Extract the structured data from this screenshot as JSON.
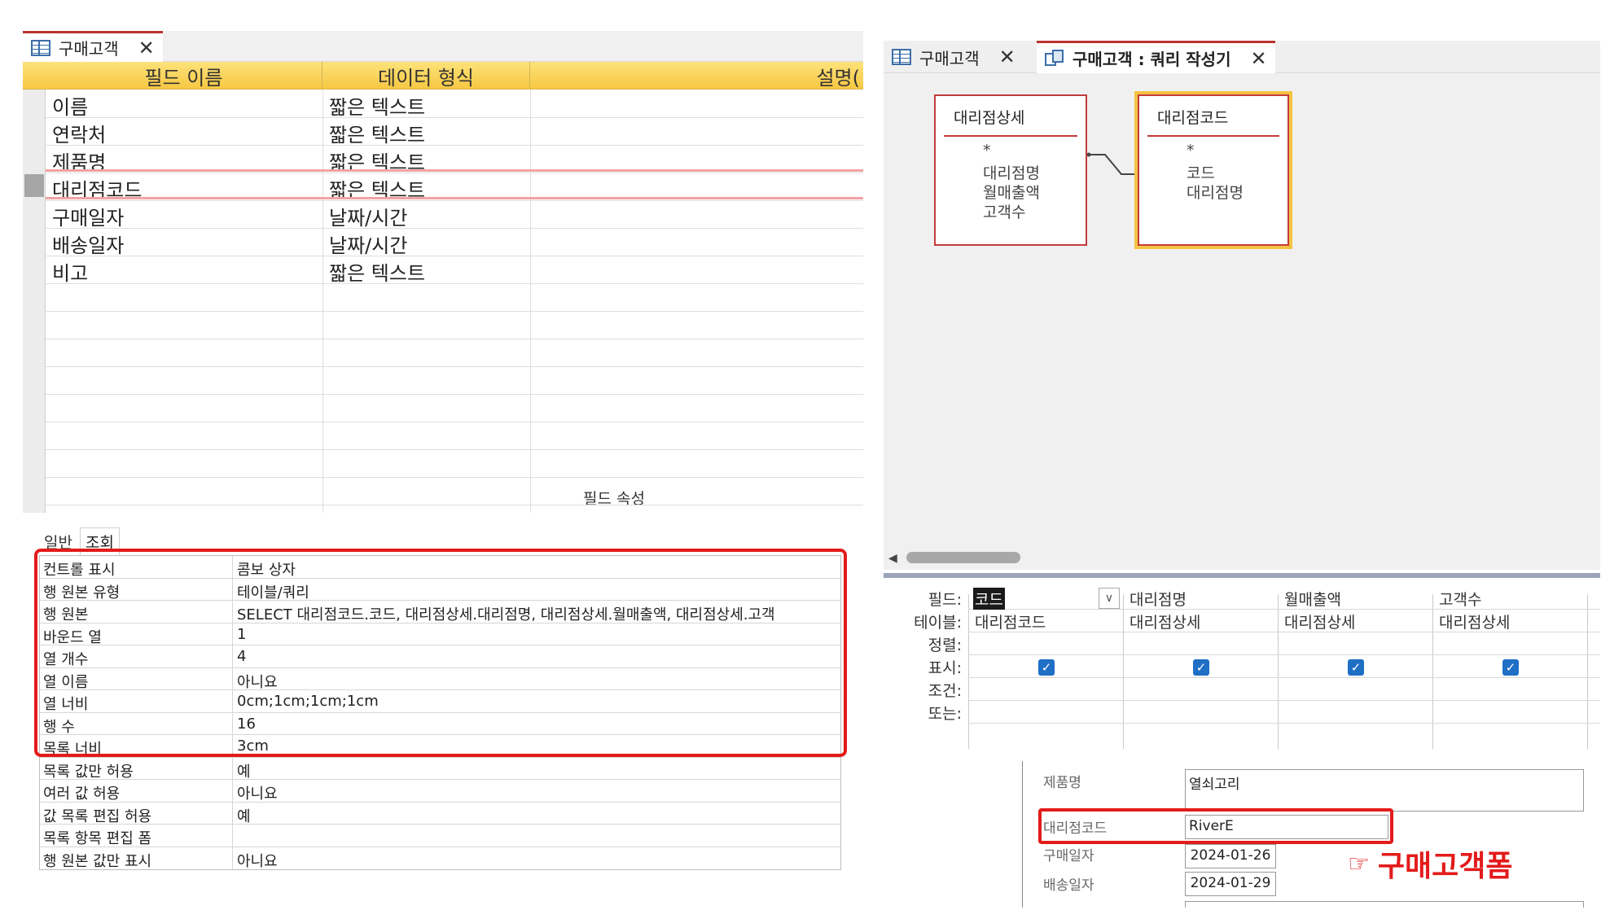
{
  "left_tab": {
    "title": "구매고객",
    "close": "✕"
  },
  "columns": {
    "field_name": "필드 이름",
    "data_type": "데이터 형식",
    "description": "설명("
  },
  "fields": [
    {
      "name": "이름",
      "type": "짧은 텍스트"
    },
    {
      "name": "연락처",
      "type": "짧은 텍스트"
    },
    {
      "name": "제품명",
      "type": "짧은 텍스트"
    },
    {
      "name": "대리점코드",
      "type": "짧은 텍스트"
    },
    {
      "name": "구매일자",
      "type": "날짜/시간"
    },
    {
      "name": "배송일자",
      "type": "날짜/시간"
    },
    {
      "name": "비고",
      "type": "짧은 텍스트"
    }
  ],
  "field_properties": {
    "title": "필드 속성",
    "tabs": {
      "general": "일반",
      "lookup": "조회"
    },
    "rows": [
      {
        "name": "컨트롤 표시",
        "value": "콤보 상자"
      },
      {
        "name": "행 원본 유형",
        "value": "테이블/쿼리"
      },
      {
        "name": "행 원본",
        "value": "SELECT 대리점코드.코드, 대리점상세.대리점명, 대리점상세.월매출액, 대리점상세.고객"
      },
      {
        "name": "바운드 열",
        "value": "1"
      },
      {
        "name": "열 개수",
        "value": "4"
      },
      {
        "name": "열 이름",
        "value": "아니요"
      },
      {
        "name": "열 너비",
        "value": "0cm;1cm;1cm;1cm"
      },
      {
        "name": "행 수",
        "value": "16"
      },
      {
        "name": "목록 너비",
        "value": "3cm"
      },
      {
        "name": "목록 값만 허용",
        "value": "예"
      },
      {
        "name": "여러 값 허용",
        "value": "아니요"
      },
      {
        "name": "값 목록 편집 허용",
        "value": "예"
      },
      {
        "name": "목록 항목 편집 폼",
        "value": ""
      },
      {
        "name": "행 원본 값만 표시",
        "value": "아니요"
      }
    ]
  },
  "right_tabs": [
    {
      "title": "구매고객",
      "close": "✕"
    },
    {
      "title": "구매고객 : 쿼리 작성기",
      "close": "✕"
    }
  ],
  "tables": [
    {
      "title": "대리점상세",
      "fields": [
        "*",
        "대리점명",
        "월매출액",
        "고객수"
      ]
    },
    {
      "title": "대리점코드",
      "fields": [
        "*",
        "코드",
        "대리점명"
      ]
    }
  ],
  "qbe": {
    "row_labels": [
      "필드:",
      "테이블:",
      "정렬:",
      "표시:",
      "조건:",
      "또는:"
    ],
    "columns": [
      {
        "field": "코드",
        "table": "대리점코드",
        "show": true
      },
      {
        "field": "대리점명",
        "table": "대리점상세",
        "show": true
      },
      {
        "field": "월매출액",
        "table": "대리점상세",
        "show": true
      },
      {
        "field": "고객수",
        "table": "대리점상세",
        "show": true
      }
    ],
    "dropdown_glyph": "∨",
    "check_glyph": "✓"
  },
  "form": {
    "product_label": "제품명",
    "product_value": "열쇠고리",
    "agency_label": "대리점코드",
    "agency_value": "RiverE",
    "purchase_label": "구매일자",
    "purchase_value": "2024-01-26",
    "delivery_label": "배송일자",
    "delivery_value": "2024-01-29",
    "caption": "구매고객폼",
    "pointer": "☞"
  },
  "colors": {
    "accent_red": "#e31b1b",
    "header_yellow": "#f7c843",
    "checkbox_blue": "#1f6fc5"
  }
}
